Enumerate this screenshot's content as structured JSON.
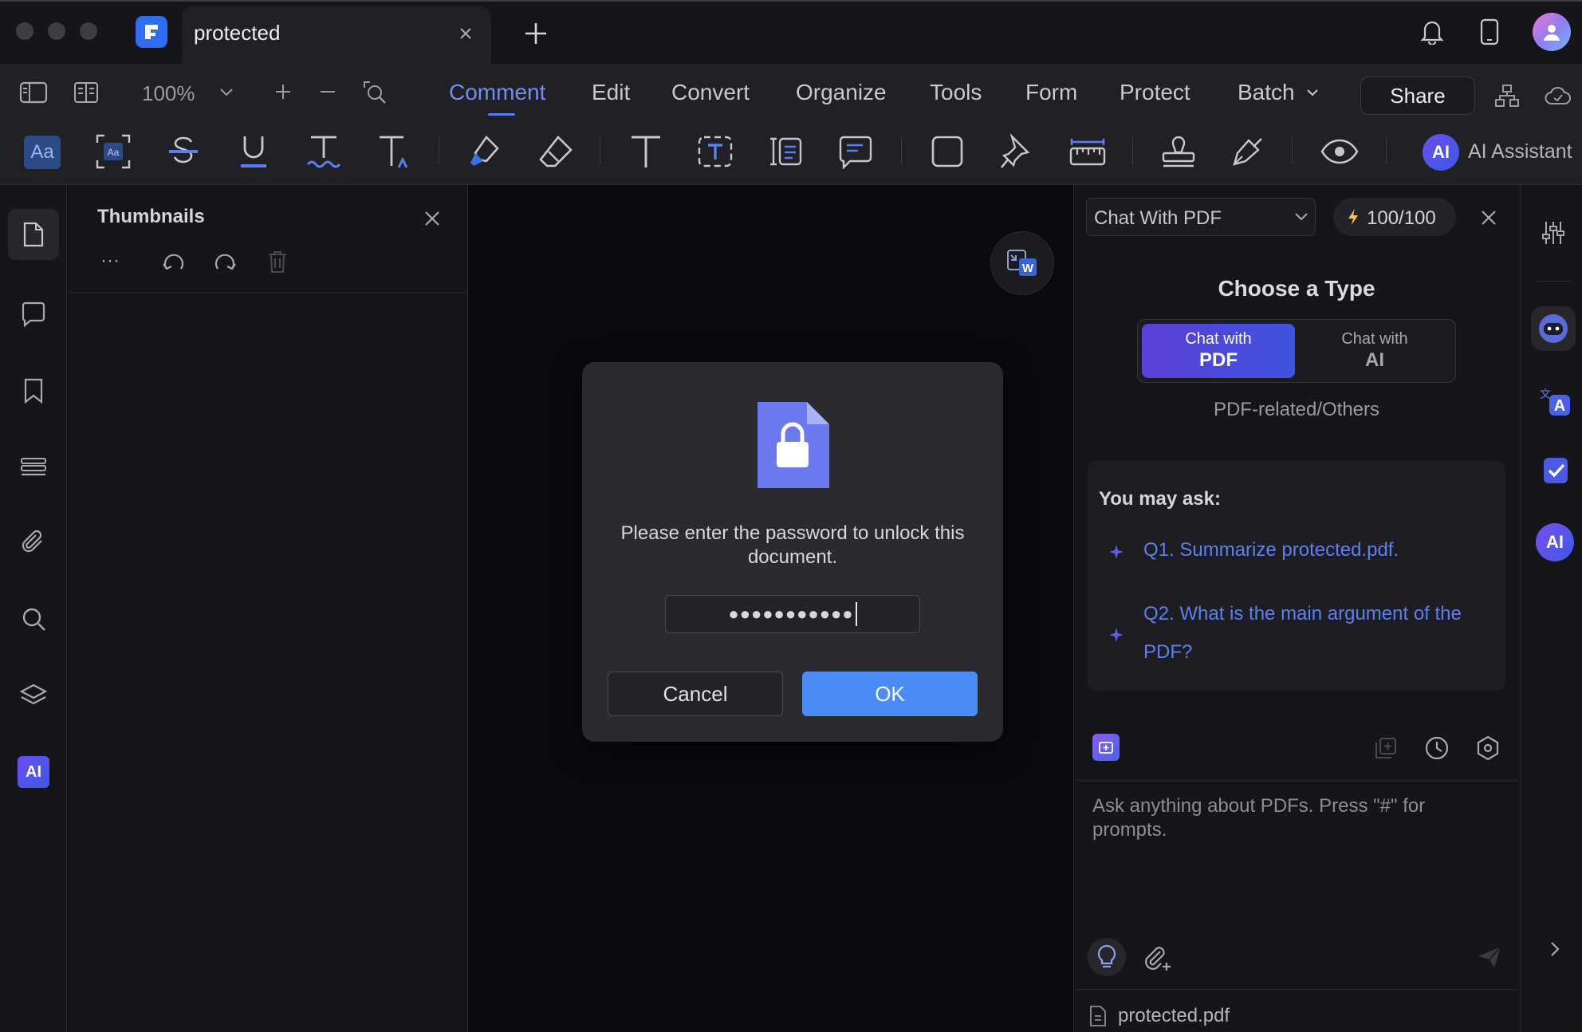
{
  "window": {
    "tab_title": "protected",
    "zoom": "100%"
  },
  "menu": {
    "items": [
      "Comment",
      "Edit",
      "Convert",
      "Organize",
      "Tools",
      "Form",
      "Protect",
      "Batch"
    ],
    "active": "Comment",
    "share_label": "Share"
  },
  "toolbar": {
    "ai_assistant_label": "AI Assistant",
    "ai_badge": "AI"
  },
  "thumbnails": {
    "title": "Thumbnails",
    "more": "···"
  },
  "leftrail": {
    "ai_badge": "AI"
  },
  "dialog": {
    "message": "Please enter the password to unlock this document.",
    "password_mask": "●●●●●●●●●●●",
    "cancel_label": "Cancel",
    "ok_label": "OK"
  },
  "ai_panel": {
    "mode_select": "Chat With PDF",
    "credits": "100/100",
    "choose_title": "Choose a Type",
    "type_pdf_top": "Chat with",
    "type_pdf_bottom": "PDF",
    "type_ai_top": "Chat with",
    "type_ai_bottom": "AI",
    "type_subtitle": "PDF-related/Others",
    "ask_title": "You may ask:",
    "questions": [
      "Q1. Summarize protected.pdf.",
      "Q2. What is the main argument of the PDF?"
    ],
    "input_placeholder": "Ask anything about PDFs. Press \"#\" for prompts.",
    "file_name": "protected.pdf"
  },
  "rightrail": {
    "ai_badge": "AI"
  },
  "colors": {
    "accent": "#4b8bf5",
    "active_menu": "#6f8ff5",
    "link": "#5d7ff0",
    "pdf_toggle": "#5b3fd6"
  }
}
